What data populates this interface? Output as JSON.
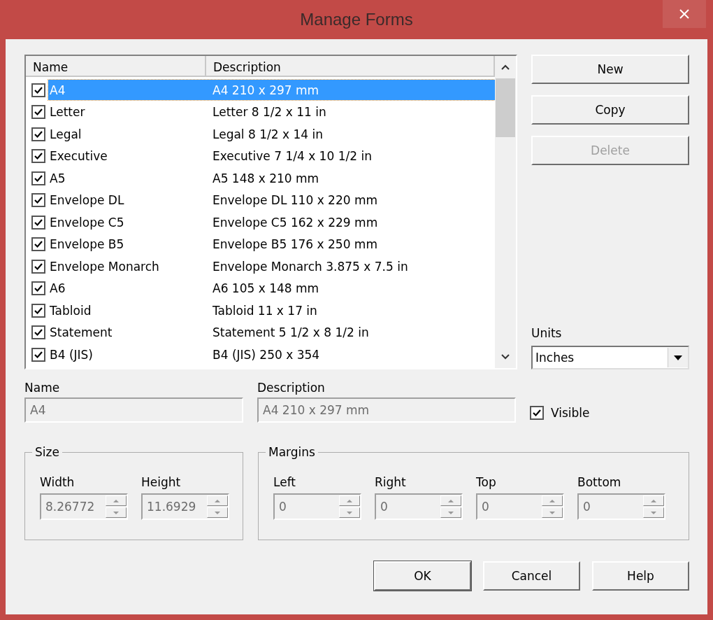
{
  "window": {
    "title": "Manage Forms"
  },
  "forms_list": {
    "columns": [
      "Name",
      "Description"
    ],
    "rows": [
      {
        "name": "A4",
        "description": "A4 210 x 297 mm",
        "checked": true,
        "selected": true
      },
      {
        "name": "Letter",
        "description": "Letter 8 1/2 x 11 in",
        "checked": true,
        "selected": false
      },
      {
        "name": "Legal",
        "description": "Legal 8 1/2 x 14 in",
        "checked": true,
        "selected": false
      },
      {
        "name": "Executive",
        "description": "Executive 7 1/4 x 10 1/2 in",
        "checked": true,
        "selected": false
      },
      {
        "name": "A5",
        "description": "A5 148 x 210 mm",
        "checked": true,
        "selected": false
      },
      {
        "name": "Envelope DL",
        "description": "Envelope DL 110 x 220 mm",
        "checked": true,
        "selected": false
      },
      {
        "name": "Envelope C5",
        "description": "Envelope C5 162 x 229 mm",
        "checked": true,
        "selected": false
      },
      {
        "name": "Envelope B5",
        "description": "Envelope B5  176 x 250 mm",
        "checked": true,
        "selected": false
      },
      {
        "name": "Envelope Monarch",
        "description": "Envelope Monarch 3.875 x 7.5 in",
        "checked": true,
        "selected": false
      },
      {
        "name": "A6",
        "description": "A6 105 x 148 mm",
        "checked": true,
        "selected": false
      },
      {
        "name": "Tabloid",
        "description": "Tabloid 11 x 17 in",
        "checked": true,
        "selected": false
      },
      {
        "name": "Statement",
        "description": "Statement 5 1/2 x 8 1/2 in",
        "checked": true,
        "selected": false
      },
      {
        "name": "B4 (JIS)",
        "description": "B4 (JIS) 250 x 354",
        "checked": true,
        "selected": false
      }
    ]
  },
  "side_buttons": [
    {
      "label": "New",
      "disabled": false
    },
    {
      "label": "Copy",
      "disabled": false
    },
    {
      "label": "Delete",
      "disabled": true
    }
  ],
  "units": {
    "label": "Units",
    "value": "Inches"
  },
  "name_field": {
    "label": "Name",
    "value": "A4",
    "disabled": true
  },
  "description_field": {
    "label": "Description",
    "value": "A4 210 x 297 mm",
    "disabled": true
  },
  "visible": {
    "label": "Visible",
    "checked": true
  },
  "size": {
    "title": "Size",
    "fields": [
      {
        "label": "Width",
        "value": "8.26772",
        "disabled": true
      },
      {
        "label": "Height",
        "value": "11.6929",
        "disabled": true
      }
    ]
  },
  "margins": {
    "title": "Margins",
    "fields": [
      {
        "label": "Left",
        "value": "0",
        "disabled": true
      },
      {
        "label": "Right",
        "value": "0",
        "disabled": true
      },
      {
        "label": "Top",
        "value": "0",
        "disabled": true
      },
      {
        "label": "Bottom",
        "value": "0",
        "disabled": true
      }
    ]
  },
  "buttons": [
    {
      "label": "OK",
      "default": true
    },
    {
      "label": "Cancel",
      "default": false
    },
    {
      "label": "Help",
      "default": false
    }
  ]
}
